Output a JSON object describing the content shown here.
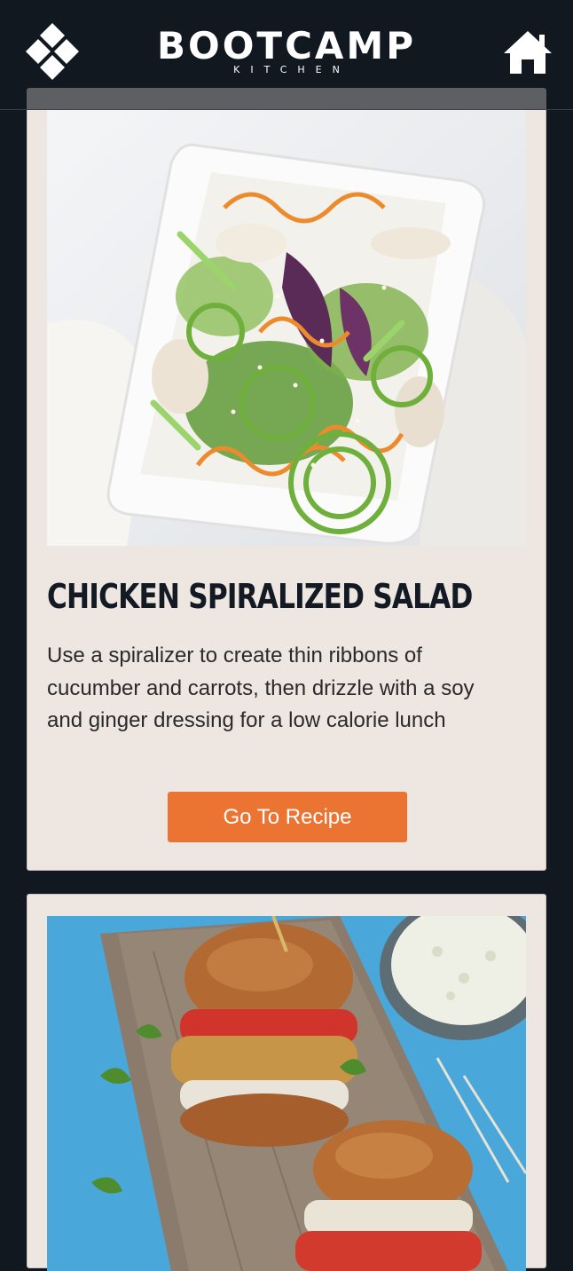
{
  "header": {
    "logo_main": "BOOTCAMP",
    "logo_sub": "KITCHEN",
    "menu_icon": "diamond-menu-icon",
    "home_icon": "home-icon"
  },
  "cards": [
    {
      "image": "chicken-spiralized-salad-photo",
      "title": "CHICKEN SPIRALIZED SALAD",
      "description": "Use a spiralizer to create thin ribbons of cucumber and carrots, then drizzle with a soy and ginger dressing for a low calorie lunch",
      "button_label": "Go To Recipe"
    },
    {
      "image": "chicken-burger-photo"
    }
  ],
  "colors": {
    "background": "#111820",
    "card": "#ede6e1",
    "button": "#eb7432",
    "title": "#131a24"
  }
}
